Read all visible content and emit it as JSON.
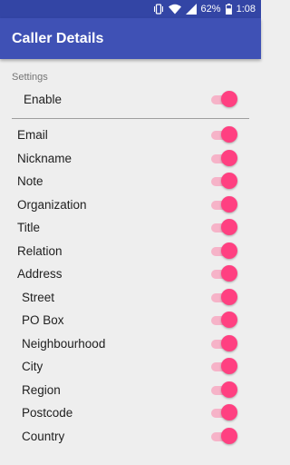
{
  "status_bar": {
    "battery": "62%",
    "time": "1:08",
    "icons": [
      "vibrate-icon",
      "wifi-icon",
      "signal-icon",
      "battery-icon"
    ]
  },
  "app_bar": {
    "title": "Caller Details"
  },
  "colors": {
    "status_bar": "#3345a5",
    "app_bar": "#3f51b5",
    "accent": "#ff4081",
    "switch_track": "#f6b3c8"
  },
  "settings": {
    "section_title": "Settings",
    "enable": {
      "label": "Enable",
      "checked": true
    }
  },
  "fields": [
    {
      "label": "Email",
      "checked": true
    },
    {
      "label": "Nickname",
      "checked": true
    },
    {
      "label": "Note",
      "checked": true
    },
    {
      "label": "Organization",
      "checked": true
    },
    {
      "label": "Title",
      "checked": true
    },
    {
      "label": "Relation",
      "checked": true
    },
    {
      "label": "Address",
      "checked": true
    },
    {
      "label": "Street",
      "checked": true
    },
    {
      "label": "PO Box",
      "checked": true
    },
    {
      "label": "Neighbourhood",
      "checked": true
    },
    {
      "label": "City",
      "checked": true
    },
    {
      "label": "Region",
      "checked": true
    },
    {
      "label": "Postcode",
      "checked": true
    },
    {
      "label": "Country",
      "checked": true
    }
  ]
}
